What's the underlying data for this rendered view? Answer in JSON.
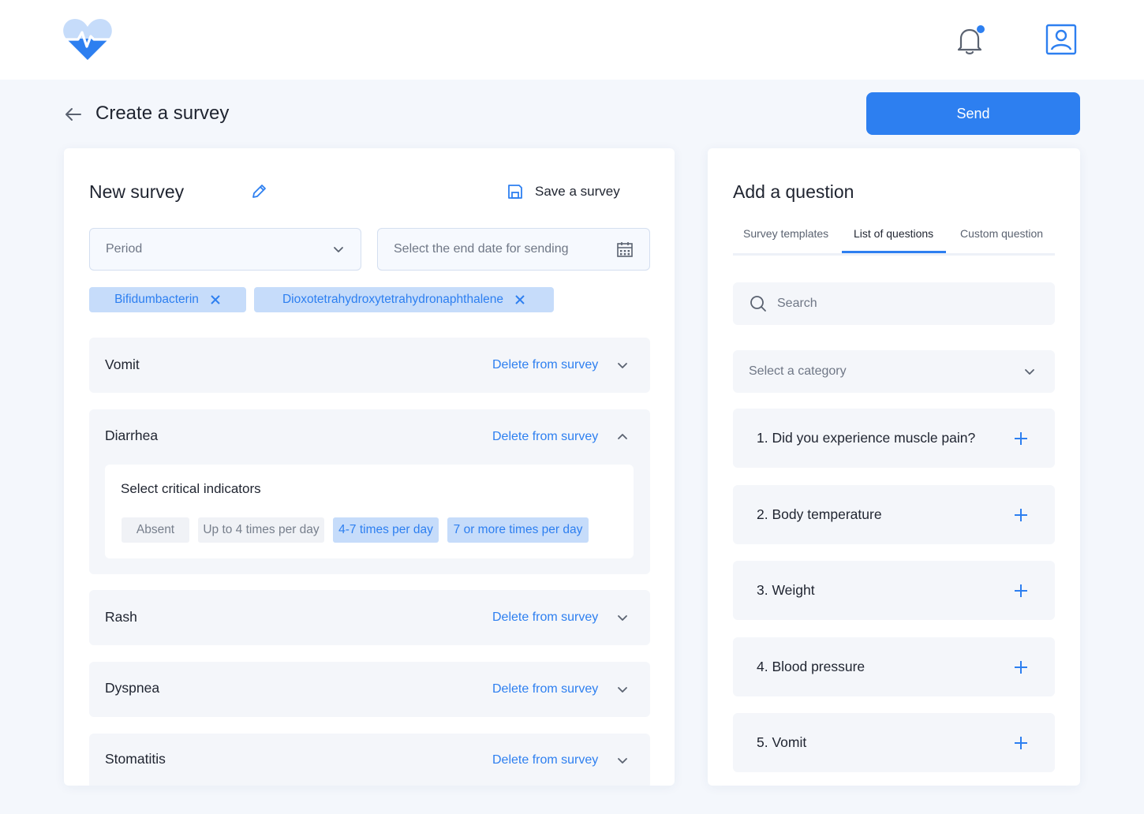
{
  "header": {
    "logo_icon": "heart-pulse-logo",
    "notification_icon": "bell-icon",
    "profile_icon": "user-profile-icon"
  },
  "page": {
    "title": "Create a survey",
    "send_label": "Send"
  },
  "survey": {
    "name": "New survey",
    "save_label": "Save a survey",
    "period_placeholder": "Period",
    "end_date_placeholder": "Select the end date for sending",
    "tags": [
      "Bifidumbacterin",
      "Dioxotetrahydroxytetrahydronaphthalene"
    ],
    "questions": [
      {
        "name": "Vomit",
        "delete_label": "Delete from survey",
        "expanded": false
      },
      {
        "name": "Diarrhea",
        "delete_label": "Delete from survey",
        "expanded": true
      },
      {
        "name": "Rash",
        "delete_label": "Delete from survey",
        "expanded": false
      },
      {
        "name": "Dyspnea",
        "delete_label": "Delete from survey",
        "expanded": false
      },
      {
        "name": "Stomatitis",
        "delete_label": "Delete from survey",
        "expanded": false
      }
    ],
    "critical": {
      "title": "Select critical indicators",
      "options": [
        {
          "label": "Absent",
          "selected": false
        },
        {
          "label": "Up to 4 times per day",
          "selected": false
        },
        {
          "label": "4-7 times per day",
          "selected": true
        },
        {
          "label": "7 or more times per day",
          "selected": true
        }
      ]
    }
  },
  "add_question": {
    "title": "Add a question",
    "tabs": [
      {
        "label": "Survey templates",
        "active": false
      },
      {
        "label": "List of questions",
        "active": true
      },
      {
        "label": "Custom question",
        "active": false
      }
    ],
    "search_placeholder": "Search",
    "category_placeholder": "Select a category",
    "questions": [
      "1. Did you experience muscle pain?",
      "2. Body temperature",
      "3. Weight",
      "4. Blood pressure",
      "5. Vomit"
    ]
  },
  "colors": {
    "accent": "#2d7ff0",
    "chip_selected_bg": "#c6dcfa",
    "page_bg": "#f4f7fc",
    "card_bg": "#f4f6fa"
  }
}
